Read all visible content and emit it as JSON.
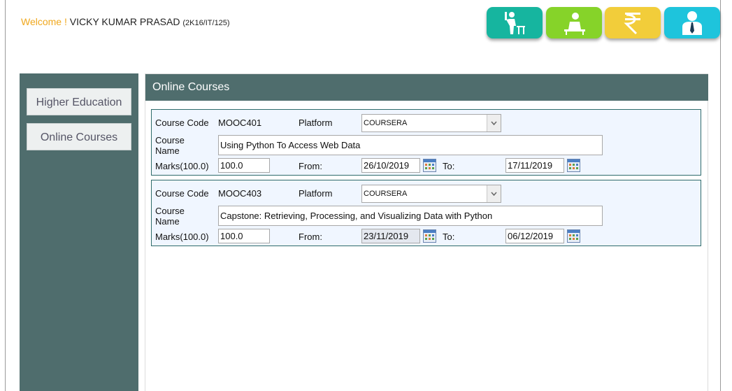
{
  "header": {
    "welcome_label": "Welcome !",
    "user_name": "VICKY KUMAR PRASAD",
    "user_code": "(2K16/IT/125)"
  },
  "top_icons": [
    {
      "name": "student-raising-hand-icon",
      "color": "#16b59f"
    },
    {
      "name": "student-at-desk-icon",
      "color": "#86d329"
    },
    {
      "name": "rupee-icon",
      "color": "#f2cd3a"
    },
    {
      "name": "person-profile-icon",
      "color": "#1ec4dc"
    }
  ],
  "sidebar": {
    "items": [
      {
        "label": "Higher Education"
      },
      {
        "label": "Online Courses"
      }
    ]
  },
  "main": {
    "title": "Online Courses"
  },
  "courses": [
    {
      "course_code_label": "Course Code",
      "course_code": "MOOC401",
      "platform_label": "Platform",
      "platform": "COURSERA",
      "course_name_label_1": "Course",
      "course_name_label_2": "Name",
      "course_name": "Using Python To Access Web Data",
      "marks_label": "Marks(100.0)",
      "marks": "100.0",
      "from_label": "From:",
      "from": "26/10/2019",
      "to_label": "To:",
      "to": "17/11/2019"
    },
    {
      "course_code_label": "Course Code",
      "course_code": "MOOC403",
      "platform_label": "Platform",
      "platform": "COURSERA",
      "course_name_label_1": "Course",
      "course_name_label_2": "Name",
      "course_name": "Capstone: Retrieving, Processing, and Visualizing Data with Python",
      "marks_label": "Marks(100.0)",
      "marks": "100.0",
      "from_label": "From:",
      "from": "23/11/2019",
      "to_label": "To:",
      "to": "06/12/2019"
    }
  ],
  "colors": {
    "accent": "#4f6d6d",
    "welcome": "#f0a81e",
    "card_bg": "#f0f6ff"
  }
}
